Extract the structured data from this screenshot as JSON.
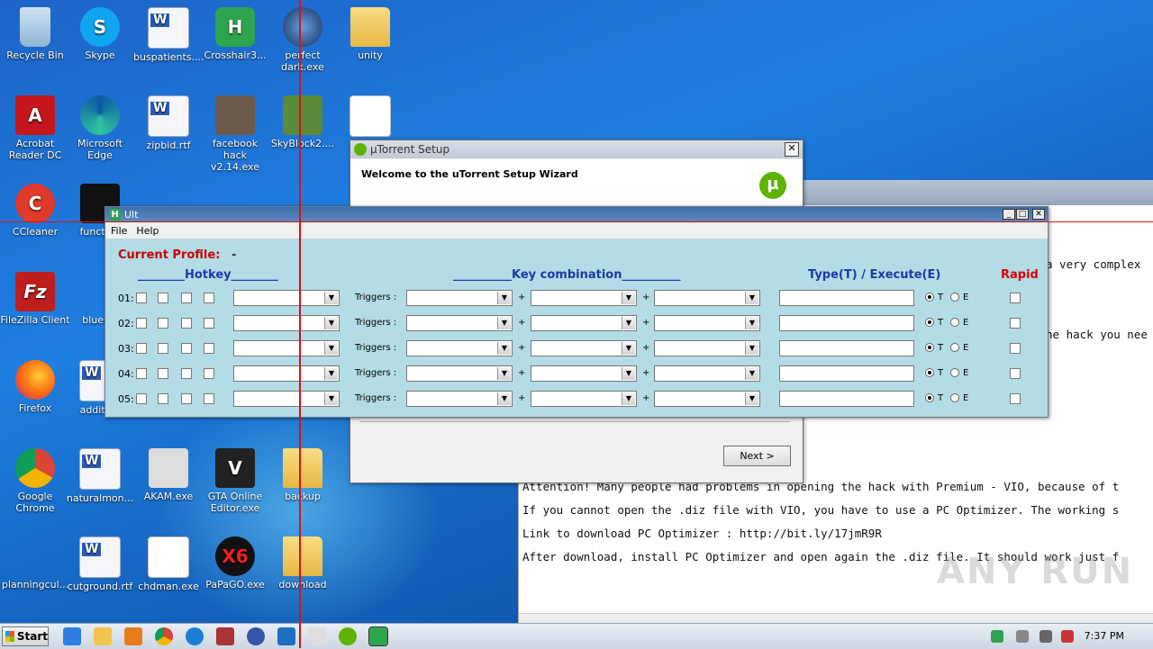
{
  "desktop": {
    "icons": [
      {
        "label": "Recycle Bin"
      },
      {
        "label": "Skype"
      },
      {
        "label": "buspatients...."
      },
      {
        "label": "Crosshair3..."
      },
      {
        "label": "perfect dark.exe"
      },
      {
        "label": "unity"
      },
      {
        "label": "Acrobat Reader DC"
      },
      {
        "label": "Microsoft Edge"
      },
      {
        "label": "zipbid.rtf"
      },
      {
        "label": "facebook hack v2.14.exe"
      },
      {
        "label": "SkyBlock2...."
      },
      {
        "label": "CCleaner"
      },
      {
        "label": "function"
      },
      {
        "label": "FileZilla Client"
      },
      {
        "label": "bluewe"
      },
      {
        "label": "Firefox"
      },
      {
        "label": "addition"
      },
      {
        "label": "Google Chrome"
      },
      {
        "label": "naturalmon..."
      },
      {
        "label": "AKAM.exe"
      },
      {
        "label": "GTA Online Editor.exe"
      },
      {
        "label": "backup"
      },
      {
        "label": "planningcul..."
      },
      {
        "label": "cutground.rtf"
      },
      {
        "label": "chdman.exe"
      },
      {
        "label": "PaPaGO.exe"
      },
      {
        "label": "download"
      }
    ]
  },
  "bg_text": {
    "fragments": [
      "a very complex",
      "he hack you nee"
    ],
    "lines": [
      "Attention! Many people had problems in opening the hack with Premium - VIO, because of t",
      "If you cannot open the .diz file with VIO, you have to use a PC Optimizer. The working s",
      "Link to download  PC Optimizer : http://bit.ly/17jmR9R",
      "After download, install PC Optimizer and open again the .diz file. It should work just f"
    ],
    "watermark": "ANY RUN"
  },
  "utorrent": {
    "title": "µTorrent Setup",
    "welcome": "Welcome to the uTorrent Setup Wizard",
    "next_label": "Next >",
    "close": "✕"
  },
  "ult": {
    "title": "Ult",
    "menu": [
      "File",
      "Help"
    ],
    "profile_label": "Current Profile:",
    "profile_value": "-",
    "headers": {
      "hotkey": "________Hotkey________",
      "keycombo": "__________Key combination__________",
      "type": "Type(T) / Execute(E)",
      "rapid": "Rapid"
    },
    "rows": [
      {
        "num": "01:",
        "triggers": "Triggers :",
        "plus": "+",
        "t": "T",
        "e": "E"
      },
      {
        "num": "02:",
        "triggers": "Triggers :",
        "plus": "+",
        "t": "T",
        "e": "E"
      },
      {
        "num": "03:",
        "triggers": "Triggers :",
        "plus": "+",
        "t": "T",
        "e": "E"
      },
      {
        "num": "04:",
        "triggers": "Triggers :",
        "plus": "+",
        "t": "T",
        "e": "E"
      },
      {
        "num": "05:",
        "triggers": "Triggers :",
        "plus": "+",
        "t": "T",
        "e": "E"
      }
    ]
  },
  "taskbar": {
    "start": "Start",
    "clock": "7:37 PM"
  },
  "colors": {
    "crosshair": "#e01010",
    "ult_bg": "#b3dce6",
    "header_blue": "#1a3aa8",
    "header_red": "#d00000"
  }
}
